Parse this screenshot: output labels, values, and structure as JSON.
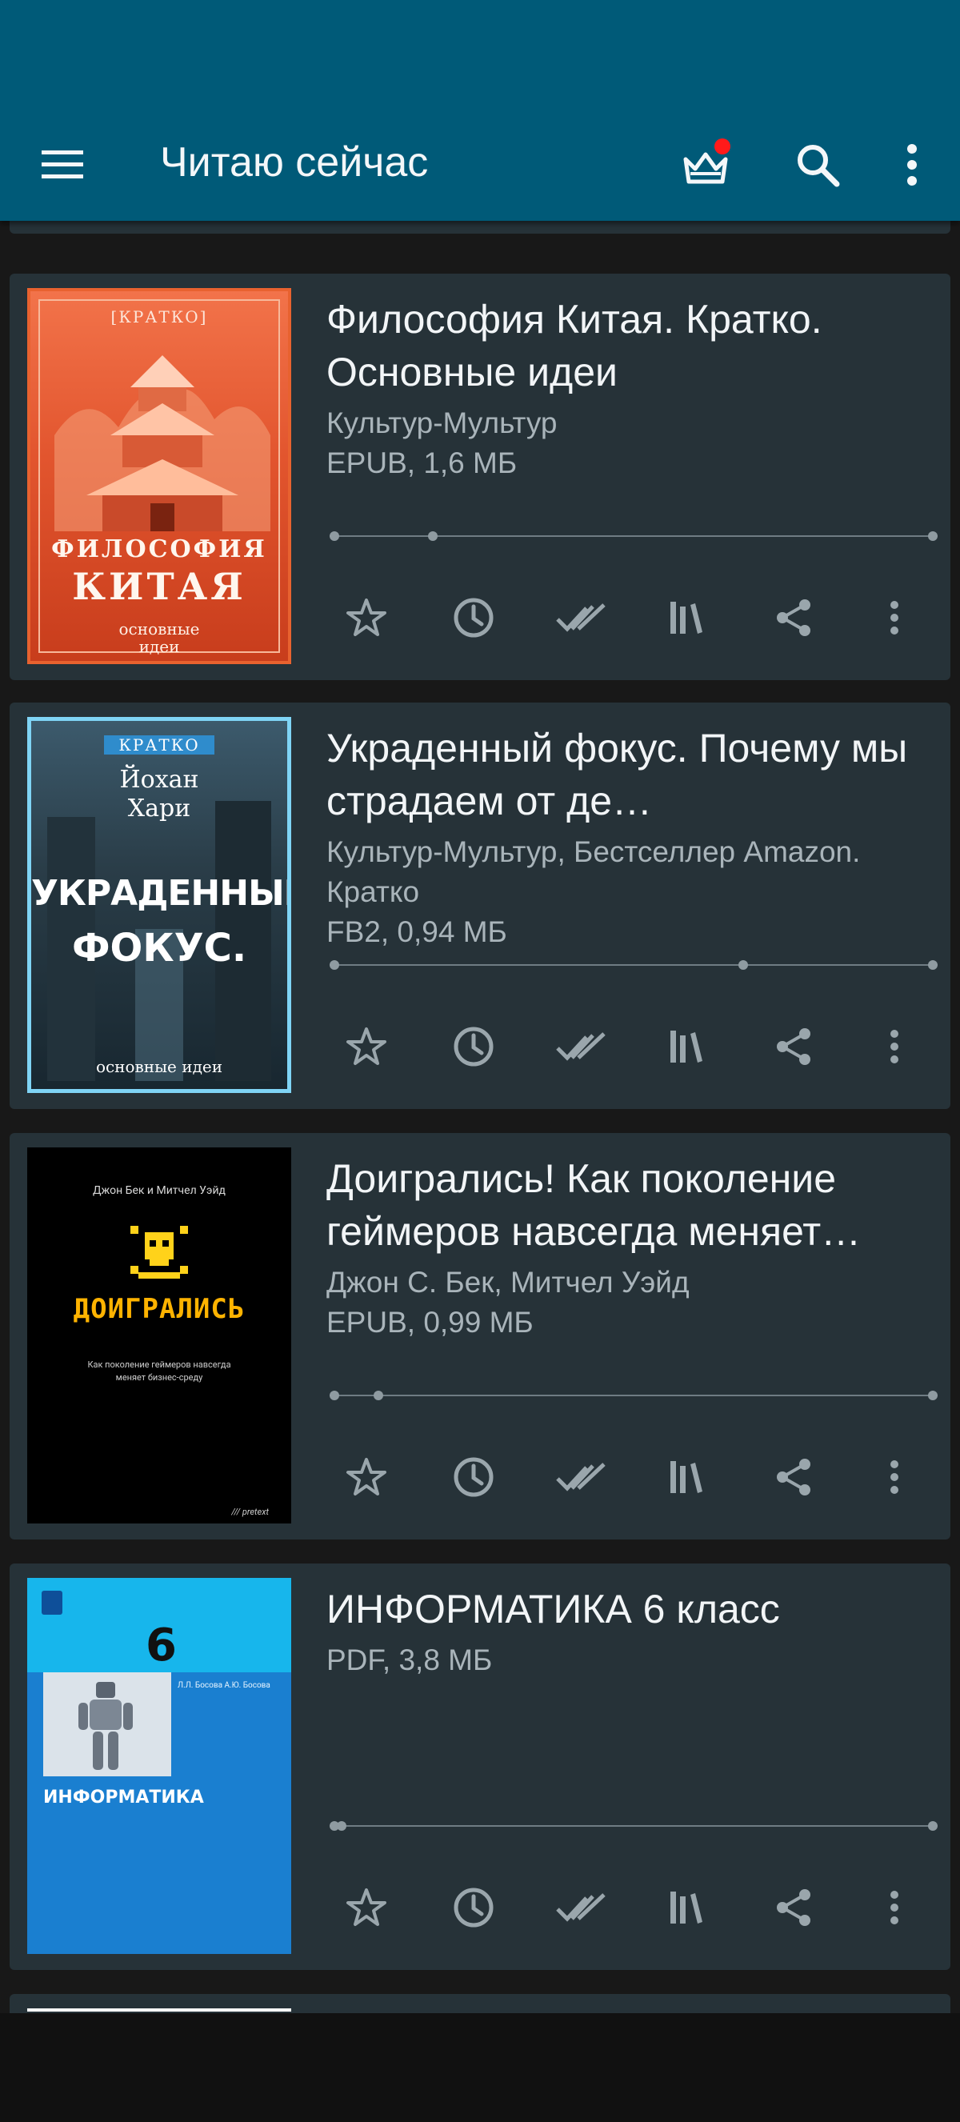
{
  "toolbar": {
    "title": "Читаю сейчас",
    "icons": [
      "menu-icon",
      "crown-icon",
      "search-icon",
      "more-vert-icon"
    ],
    "badge_color": "#ff1a1a"
  },
  "books": [
    {
      "title": "Философия Китая. Кратко. Основные идеи",
      "author": "Культур-Мультур",
      "file": "EPUB, 1,6 МБ",
      "progress": 0.17,
      "cover": {
        "tag": "[КРАТКО]",
        "line1": "ФИЛОСОФИЯ",
        "line2": "КИТАЯ",
        "line3": "основные",
        "line4": "идеи"
      }
    },
    {
      "title": "Украденный фокус. Почему мы страдаем от де…",
      "author": "Культур-Мультур, Бестселлер Amazon. Кратко",
      "file": "FB2, 0,94 МБ",
      "progress": 0.68,
      "cover": {
        "tag": "КРАТКО",
        "author1": "Йохан",
        "author2": "Хари",
        "line1": "УКРАДЕННЫЙ",
        "line2": "ФОКУС.",
        "line3": "основные идеи"
      }
    },
    {
      "title": "Доигрались! Как поколение геймеров навсегда меняет…",
      "author": "Джон С. Бек, Митчел Уэйд",
      "file": "EPUB, 0,99 МБ",
      "progress": 0.08,
      "cover": {
        "authors": "Джон Бек и Митчел Уэйд",
        "title": "ДОИГРАЛИСЬ",
        "sub": "Как поколение геймеров навсегда меняет бизнес-среду",
        "publisher": "/// pretext"
      }
    },
    {
      "title": "ИНФОРМАТИКА 6 класс",
      "author": "",
      "file": "PDF, 3,8 МБ",
      "progress": 0.02,
      "cover": {
        "grade": "6",
        "authors": "Л.Л. Босова А.Ю. Босова",
        "title": "ИНФОРМАТИКА"
      }
    }
  ],
  "actions": [
    "star-icon",
    "clock-icon",
    "done-all-icon",
    "library-icon",
    "share-icon",
    "more-vert-icon"
  ]
}
